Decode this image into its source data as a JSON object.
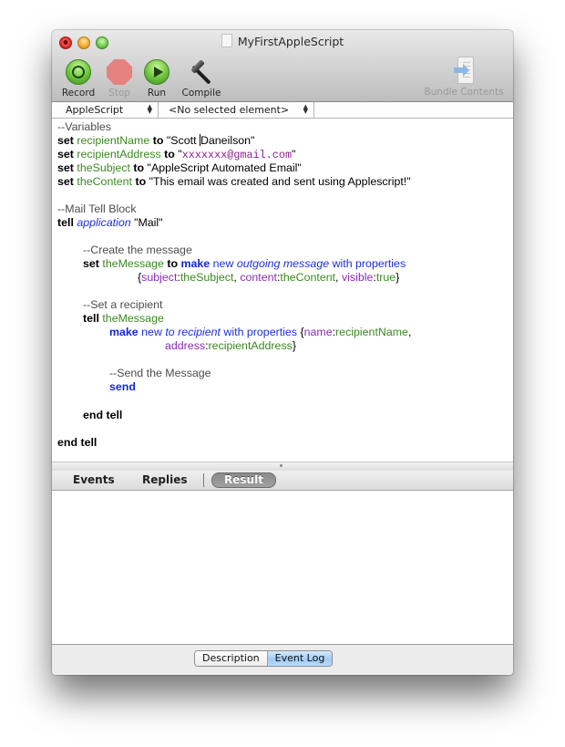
{
  "window": {
    "title": "MyFirstAppleScript"
  },
  "toolbar": {
    "record": "Record",
    "stop": "Stop",
    "run": "Run",
    "compile": "Compile",
    "bundle_contents": "Bundle Contents"
  },
  "navbar": {
    "language": "AppleScript",
    "element": "<No selected element>"
  },
  "code": {
    "l1": "--Variables",
    "set": "set",
    "to": "to",
    "v_recipientName": "recipientName",
    "s_name_a": "\"Scott ",
    "s_name_b": "Daneilson\"",
    "v_recipientAddress": "recipientAddress",
    "s_addr_q1": "\"",
    "s_addr": "xxxxxxx@gmail.com",
    "s_addr_q2": "\"",
    "v_theSubject": "theSubject",
    "s_subject": "\"AppleScript Automated Email\"",
    "v_theContent": "theContent",
    "s_content": "\"This email was created and sent using Applescript!\"",
    "c_mail": "--Mail Tell Block",
    "tell": "tell",
    "application": "application",
    "s_mail": "\"Mail\"",
    "c_create": "--Create the message",
    "v_theMessage": "theMessage",
    "make": "make",
    "new": "new",
    "outgoing_message": "outgoing message",
    "with_properties": "with properties",
    "brace_open": "{",
    "p_subject": "subject",
    "colon": ":",
    "comma_sp": ", ",
    "p_content": "content",
    "p_visible": "visible",
    "true_val": "true",
    "brace_close": "}",
    "c_recipient": "--Set a recipient",
    "to_recipient": "to recipient",
    "p_name": "name",
    "comma": ",",
    "p_address": "address",
    "c_send": "--Send the Message",
    "send": "send",
    "end_tell": "end tell"
  },
  "result_tabs": {
    "events": "Events",
    "replies": "Replies",
    "result": "Result"
  },
  "bottom": {
    "description": "Description",
    "event_log": "Event Log",
    "selected": "Event Log"
  }
}
